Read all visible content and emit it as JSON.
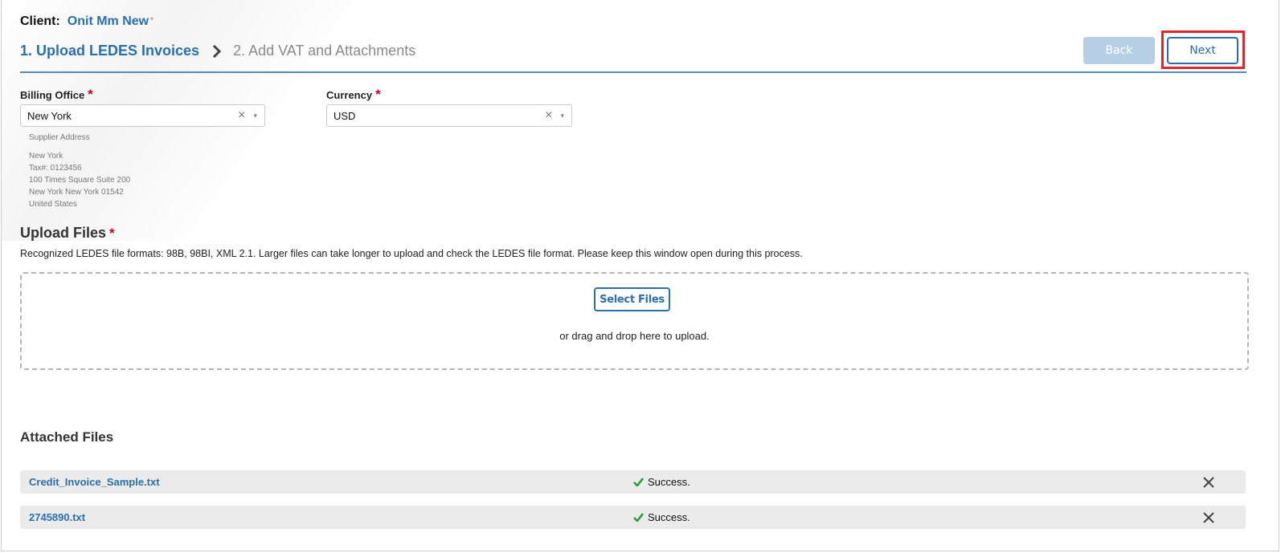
{
  "client": {
    "label": "Client:",
    "name": "Onit Mm New",
    "caret": "▾"
  },
  "steps": [
    {
      "label": "1. Upload LEDES Invoices",
      "active": true
    },
    {
      "label": "2. Add VAT and Attachments",
      "active": false
    }
  ],
  "nav": {
    "back_label": "Back",
    "next_label": "Next"
  },
  "billing_office": {
    "label": "Billing Office",
    "required_mark": "*",
    "value": "New York",
    "clear": "×",
    "caret": "▾"
  },
  "currency": {
    "label": "Currency",
    "required_mark": "*",
    "value": "USD",
    "clear": "×",
    "caret": "▾"
  },
  "supplier_address": {
    "title": "Supplier Address",
    "lines": [
      "New York",
      "Tax#: 0123456",
      "100 Times Square Suite 200",
      "New York New York 01542",
      "United States"
    ]
  },
  "upload": {
    "title": "Upload Files",
    "required_mark": "*",
    "description": "Recognized LEDES file formats: 98B, 98BI, XML 2.1. Larger files can take longer to upload and check the LEDES file format. Please keep this window open during this process.",
    "select_label": "Select Files",
    "drop_hint": "or drag and drop here to upload."
  },
  "attached": {
    "title": "Attached Files",
    "files": [
      {
        "name": "Credit_Invoice_Sample.txt",
        "status": "Success."
      },
      {
        "name": "2745890.txt",
        "status": "Success."
      }
    ]
  },
  "colors": {
    "primary": "#2a6fb0",
    "required": "#d0021b",
    "highlight": "#e3262b",
    "success": "#2e9a3a",
    "back_disabled": "#b7cfe4"
  },
  "icons": {
    "step_separator": "chevron-right-icon",
    "status": "check-icon",
    "remove": "close-icon"
  }
}
